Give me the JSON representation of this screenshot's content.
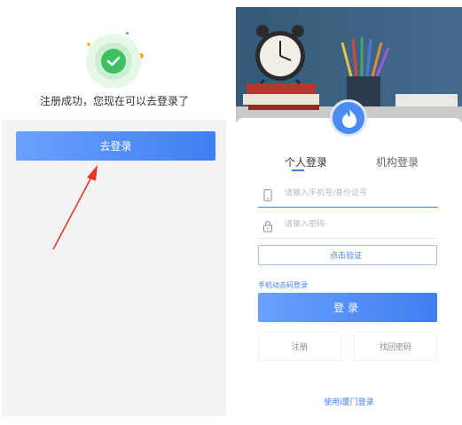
{
  "left": {
    "success_message": "注册成功，您现在可以去登录了",
    "go_login_label": "去登录",
    "colors": {
      "success": "#3fbf62",
      "primary": "#3f7ff0",
      "arrow": "#e8362f"
    }
  },
  "right": {
    "tabs": [
      {
        "label": "个人登录",
        "active": true
      },
      {
        "label": "机构登录",
        "active": false
      }
    ],
    "phone_placeholder": "请输入手机号/身份证号",
    "password_placeholder": "请输入密码",
    "verify_label": "点击验证",
    "sms_login_label": "手机动态码登录",
    "login_label": "登录",
    "register_label": "注册",
    "forgot_label": "找回密码",
    "xiamen_login_label": "使用i厦门登录"
  }
}
